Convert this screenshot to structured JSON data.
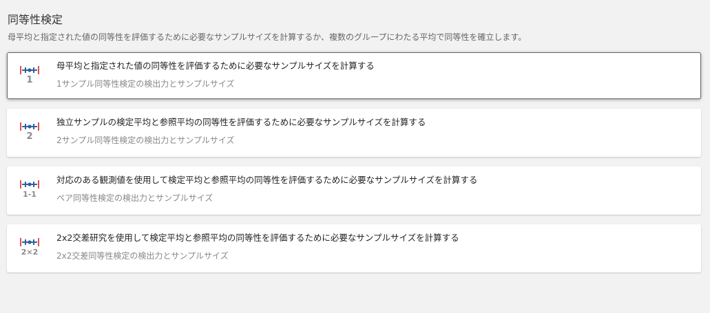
{
  "header": {
    "title": "同等性検定",
    "description": "母平均と指定された値の同等性を評価するために必要なサンプルサイズを計算するか、複数のグループにわたる平均で同等性を確立します。"
  },
  "cards": [
    {
      "icon": "one-sample-equivalence-icon",
      "icon_label": "1",
      "title": "母平均と指定された値の同等性を評価するために必要なサンプルサイズを計算する",
      "subtitle": "1サンプル同等性検定の検出力とサンプルサイズ",
      "selected": true
    },
    {
      "icon": "two-sample-equivalence-icon",
      "icon_label": "2",
      "title": "独立サンプルの検定平均と参照平均の同等性を評価するために必要なサンプルサイズを計算する",
      "subtitle": "2サンプル同等性検定の検出力とサンプルサイズ",
      "selected": false
    },
    {
      "icon": "paired-equivalence-icon",
      "icon_label": "1-1",
      "title": "対応のある観測値を使用して検定平均と参照平均の同等性を評価するために必要なサンプルサイズを計算する",
      "subtitle": "ペア同等性検定の検出力とサンプルサイズ",
      "selected": false
    },
    {
      "icon": "crossover-equivalence-icon",
      "icon_label": "2×2",
      "title": "2x2交差研究を使用して検定平均と参照平均の同等性を評価するために必要なサンプルサイズを計算する",
      "subtitle": "2x2交差同等性検定の検出力とサンプルサイズ",
      "selected": false
    }
  ],
  "colors": {
    "icon_red": "#d9534f",
    "icon_blue": "#2f5f9e",
    "icon_gray": "#8a8a8a",
    "selected_border": "#666666"
  }
}
